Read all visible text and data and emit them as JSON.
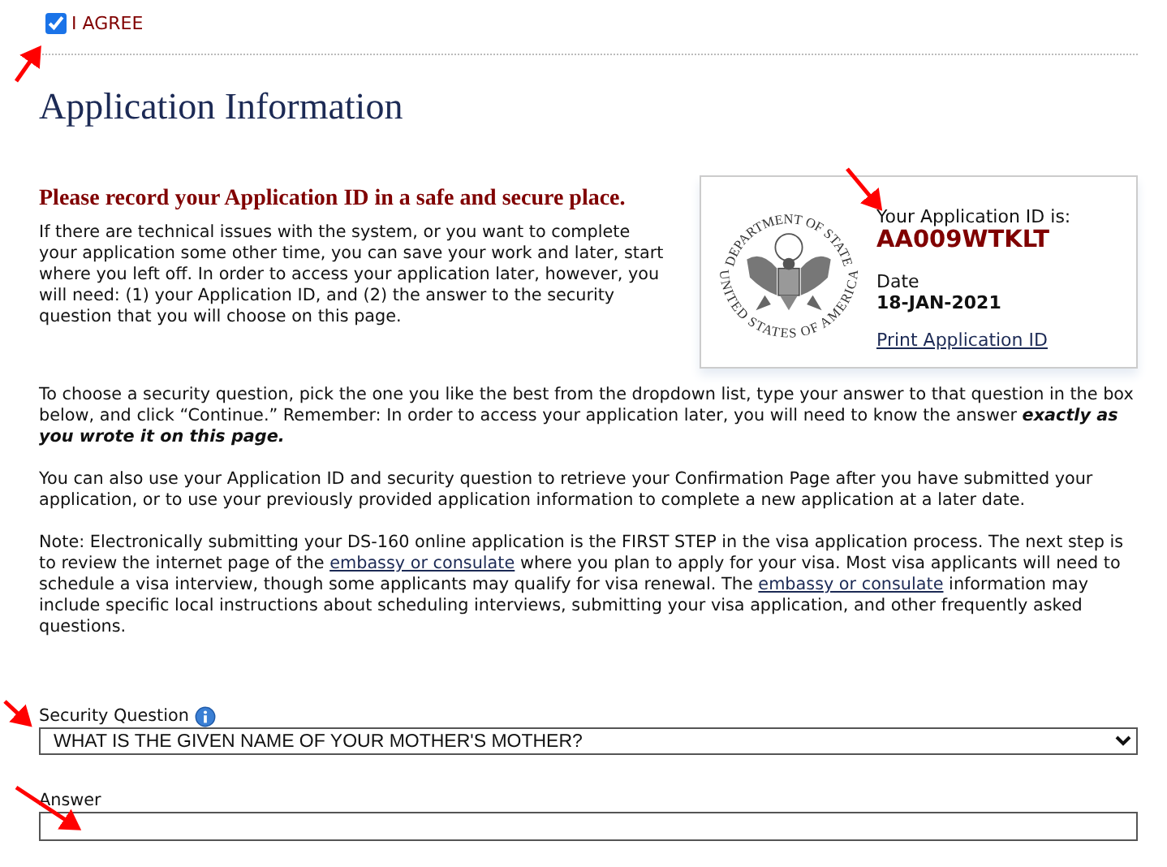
{
  "agree": {
    "label": "I AGREE",
    "checked": true
  },
  "heading": "Application Information",
  "notice_title": "Please record your Application ID in a safe and secure place.",
  "id_card": {
    "seal_top_text": "DEPARTMENT OF STATE",
    "seal_bottom_text": "UNITED STATES OF AMERICA",
    "label": "Your Application ID is:",
    "application_id": "AA009WTKLT",
    "date_label": "Date",
    "date": "18-JAN-2021",
    "print_link": "Print Application ID"
  },
  "paragraphs": [
    [
      {
        "kind": "text",
        "text": "If there are technical issues with the system, or you want to complete your application some other time, you can save your work and later, start where you left off. In order to access your application later, however, you will need: (1) your Application ID, and (2) the answer to the security question that you will choose on this page."
      }
    ],
    [
      {
        "kind": "text",
        "text": "To choose a security question, pick the one you like the best from the dropdown list, type your answer to that question in the box below, and click “Continue.” Remember: In order to access your application later, you will need to know the answer **exactly as you wrote it on this page.**"
      }
    ],
    [
      {
        "kind": "text",
        "text": "You can also use your Application ID and security question to retrieve your Confirmation Page after you have submitted your application, or to use your previously provided application information to complete a new application at a later date."
      }
    ],
    [
      {
        "kind": "text",
        "text": "Note: Electronically submitting your DS-160 online application is the FIRST STEP in the visa application process. The next step is to review the internet page of the "
      },
      {
        "kind": "link",
        "text": "embassy or consulate"
      },
      {
        "kind": "text",
        "text": " where you plan to apply for your visa. Most visa applicants will need to schedule a visa interview, though some applicants may qualify for visa renewal. The "
      },
      {
        "kind": "link",
        "text": "embassy or consulate"
      },
      {
        "kind": "text",
        "text": " information may include specific local instructions about scheduling interviews, submitting your visa application, and other frequently asked questions."
      }
    ]
  ],
  "security_question": {
    "label": "Security Question",
    "value": "WHAT IS THE GIVEN NAME OF YOUR MOTHER'S MOTHER?"
  },
  "answer": {
    "label": "Answer"
  }
}
